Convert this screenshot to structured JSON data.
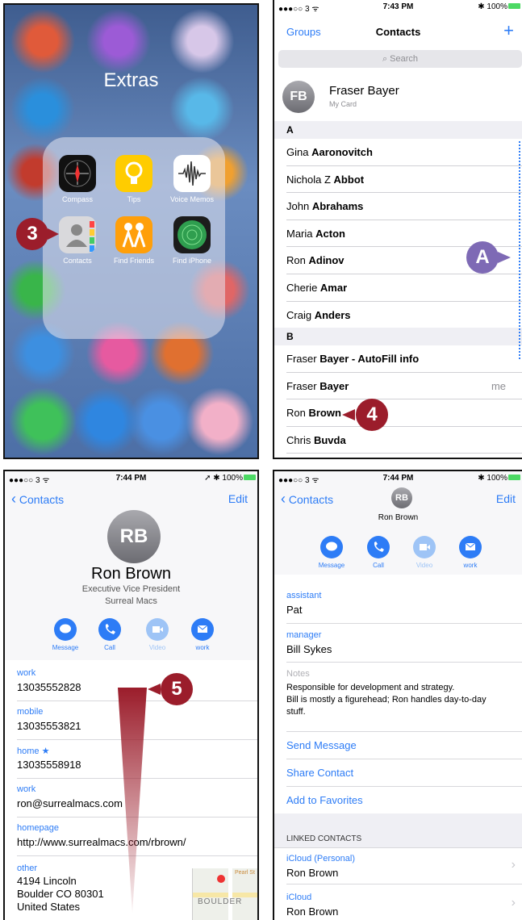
{
  "panel1": {
    "folder_title": "Extras",
    "apps": [
      {
        "label": "Compass",
        "icon": "compass-icon"
      },
      {
        "label": "Tips",
        "icon": "lightbulb-icon"
      },
      {
        "label": "Voice Memos",
        "icon": "waveform-icon"
      },
      {
        "label": "Contacts",
        "icon": "contacts-icon"
      },
      {
        "label": "Find Friends",
        "icon": "people-icon"
      },
      {
        "label": "Find iPhone",
        "icon": "radar-icon"
      }
    ],
    "callout": "3"
  },
  "panel2": {
    "status": {
      "carrier": "●●●○○ 3 ᯤ",
      "time": "7:43 PM",
      "battery": "✱ 100%"
    },
    "nav": {
      "left": "Groups",
      "title": "Contacts",
      "right": "+"
    },
    "search_placeholder": "Search",
    "my_card": {
      "initials": "FB",
      "name": "Fraser Bayer",
      "sub": "My Card"
    },
    "section_a": "A",
    "section_b": "B",
    "contacts_a": [
      {
        "first": "Gina",
        "last": "Aaronovitch"
      },
      {
        "first": "Nichola Z",
        "last": "Abbot"
      },
      {
        "first": "John",
        "last": "Abrahams"
      },
      {
        "first": "Maria",
        "last": "Acton"
      },
      {
        "first": "Ron",
        "last": "Adinov"
      },
      {
        "first": "Cherie",
        "last": "Amar"
      },
      {
        "first": "Craig",
        "last": "Anders"
      }
    ],
    "contacts_b": [
      {
        "first": "Fraser",
        "last": "Bayer - AutoFill info",
        "extra": ""
      },
      {
        "first": "Fraser",
        "last": "Bayer",
        "extra": "me"
      },
      {
        "first": "Ron",
        "last": "Brown",
        "extra": ""
      },
      {
        "first": "Chris",
        "last": "Buvda",
        "extra": ""
      }
    ],
    "callout_a": "A",
    "callout_4": "4"
  },
  "panel3": {
    "status": {
      "carrier": "●●●○○ 3 ᯤ",
      "time": "7:44 PM",
      "battery": "➚ ✱ 100%"
    },
    "back": "Contacts",
    "edit": "Edit",
    "initials": "RB",
    "name": "Ron Brown",
    "title": "Executive Vice President",
    "company": "Surreal Macs",
    "actions": [
      "Message",
      "Call",
      "Video",
      "work"
    ],
    "fields": [
      {
        "label": "work",
        "value": "13035552828"
      },
      {
        "label": "mobile",
        "value": "13035553821"
      },
      {
        "label": "home ★",
        "value": "13035558918"
      },
      {
        "label": "work",
        "value": "ron@surrealmacs.com"
      },
      {
        "label": "homepage",
        "value": "http://www.surrealmacs.com/rbrown/"
      }
    ],
    "address": {
      "label": "other",
      "line1": "4194 Lincoln",
      "line2": "Boulder CO 80301",
      "line3": "United States"
    },
    "map_label": "BOULDER",
    "map_street": "Pearl St",
    "callout": "5"
  },
  "panel4": {
    "status": {
      "carrier": "●●●○○ 3 ᯤ",
      "time": "7:44 PM",
      "battery": "✱ 100%"
    },
    "back": "Contacts",
    "edit": "Edit",
    "initials": "RB",
    "name": "Ron Brown",
    "actions": [
      "Message",
      "Call",
      "Video",
      "work"
    ],
    "assistant_label": "assistant",
    "assistant_value": "Pat",
    "manager_label": "manager",
    "manager_value": "Bill Sykes",
    "notes_label": "Notes",
    "notes_line1": "Responsible for development and strategy.",
    "notes_line2": "Bill is mostly a figurehead; Ron handles day-to-day",
    "notes_line3": "stuff.",
    "links": [
      "Send Message",
      "Share Contact",
      "Add to Favorites"
    ],
    "linked_header": "LINKED CONTACTS",
    "linked": [
      {
        "source": "iCloud (Personal)",
        "name": "Ron Brown"
      },
      {
        "source": "iCloud",
        "name": "Ron Brown"
      }
    ]
  },
  "colors": {
    "ios_blue": "#2d7cf6",
    "callout_red": "#9b1d2b",
    "callout_purple": "#7e6ab5"
  }
}
